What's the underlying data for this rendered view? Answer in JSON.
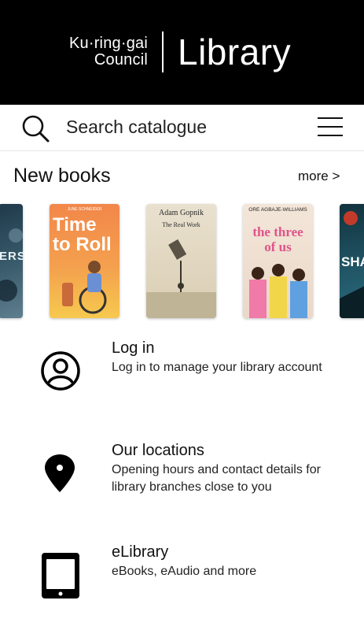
{
  "header": {
    "council_line1": "Ku·ring·gai",
    "council_line2": "Council",
    "library": "Library"
  },
  "search": {
    "placeholder": "Search catalogue"
  },
  "new_books": {
    "title": "New books",
    "more": "more >",
    "books": [
      {
        "title_text": "ERS",
        "colors": [
          "#1f3a4a",
          "#5f7f8f"
        ]
      },
      {
        "author": "JUNE SCHNEIDER",
        "title_text": "Time to Roll",
        "colors": [
          "#f2874a",
          "#f6c94f"
        ]
      },
      {
        "author": "Adam Gopnik",
        "title_text": "The Real Work",
        "colors": [
          "#d9cdb2",
          "#e9e1cf"
        ]
      },
      {
        "author": "ORE AGBAJE-WILLIAMS",
        "title_text": "the three of us",
        "colors": [
          "#ead8c8",
          "#f3e6d9"
        ]
      },
      {
        "title_text": "SHA",
        "colors": [
          "#12323d",
          "#2b6c7e"
        ]
      }
    ]
  },
  "rows": [
    {
      "icon": "user-circle-icon",
      "title": "Log in",
      "desc": "Log in to manage your library account"
    },
    {
      "icon": "map-pin-icon",
      "title": "Our locations",
      "desc": "Opening hours and contact details for library branches close to you"
    },
    {
      "icon": "tablet-icon",
      "title": "eLibrary",
      "desc": "eBooks, eAudio and more"
    }
  ],
  "colors": {
    "header_bg": "#000000",
    "text": "#111111"
  }
}
